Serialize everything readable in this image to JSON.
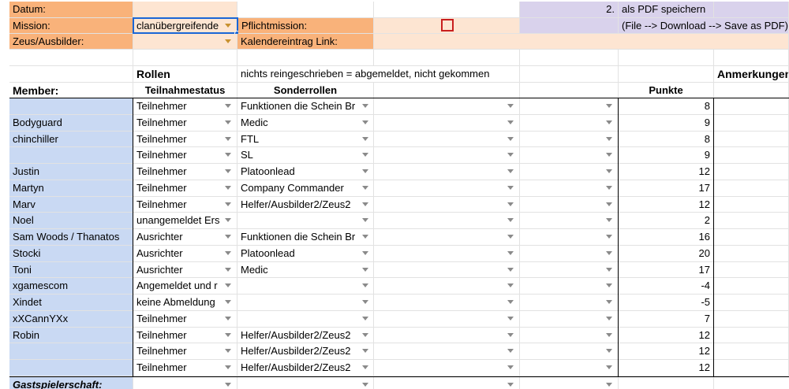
{
  "header": {
    "datum_label": "Datum:",
    "mission_label": "Mission:",
    "mission_value": "clanübergreifende",
    "pflicht_label": "Pflichtmission:",
    "zeus_label": "Zeus/Ausbilder:",
    "kalender_label": "Kalendereintrag Link:",
    "step_number": "2.",
    "pdf_label": "als PDF speichern",
    "pdf_hint": "(File --> Download --> Save as PDF)"
  },
  "section": {
    "rollen": "Rollen",
    "note": "nichts reingeschrieben = abgemeldet, nicht gekommen",
    "anmerkungen": "Anmerkungen"
  },
  "columns": {
    "member": "Member:",
    "teilnahmestatus": "Teilnahmestatus",
    "sonderrollen": "Sonderrollen",
    "punkte": "Punkte"
  },
  "rows": [
    {
      "member": "",
      "status": "Teilnehmer",
      "rolle": "Funktionen die Schein Br",
      "punkte": "8"
    },
    {
      "member": "Bodyguard",
      "status": "Teilnehmer",
      "rolle": "Medic",
      "punkte": "9"
    },
    {
      "member": "chinchiller",
      "status": "Teilnehmer",
      "rolle": "FTL",
      "punkte": "8"
    },
    {
      "member": "",
      "status": "Teilnehmer",
      "rolle": "SL",
      "punkte": "9"
    },
    {
      "member": "Justin",
      "status": "Teilnehmer",
      "rolle": "Platoonlead",
      "punkte": "12"
    },
    {
      "member": "Martyn",
      "status": "Teilnehmer",
      "rolle": "Company Commander",
      "punkte": "17"
    },
    {
      "member": "Marv",
      "status": "Teilnehmer",
      "rolle": "Helfer/Ausbilder2/Zeus2",
      "punkte": "12"
    },
    {
      "member": "Noel",
      "status": "unangemeldet Ers",
      "rolle": "",
      "punkte": "2"
    },
    {
      "member": "Sam Woods / Thanatos",
      "status": "Ausrichter",
      "rolle": "Funktionen die Schein Br",
      "punkte": "16"
    },
    {
      "member": "Stocki",
      "status": "Ausrichter",
      "rolle": "Platoonlead",
      "punkte": "20"
    },
    {
      "member": "Toni",
      "status": "Ausrichter",
      "rolle": "Medic",
      "punkte": "17"
    },
    {
      "member": "xgamescom",
      "status": "Angemeldet und r",
      "rolle": "",
      "punkte": "-4"
    },
    {
      "member": "Xindet",
      "status": "keine Abmeldung",
      "rolle": "",
      "punkte": "-5"
    },
    {
      "member": "xXCannYXx",
      "status": "Teilnehmer",
      "rolle": "",
      "punkte": "7"
    },
    {
      "member": "Robin",
      "status": "Teilnehmer",
      "rolle": "Helfer/Ausbilder2/Zeus2",
      "punkte": "12"
    },
    {
      "member": "",
      "status": "Teilnehmer",
      "rolle": "Helfer/Ausbilder2/Zeus2",
      "punkte": "12"
    },
    {
      "member": "",
      "status": "Teilnehmer",
      "rolle": "Helfer/Ausbilder2/Zeus2",
      "punkte": "12"
    }
  ],
  "footer": {
    "gastspieler": "Gastspielerschaft:"
  }
}
